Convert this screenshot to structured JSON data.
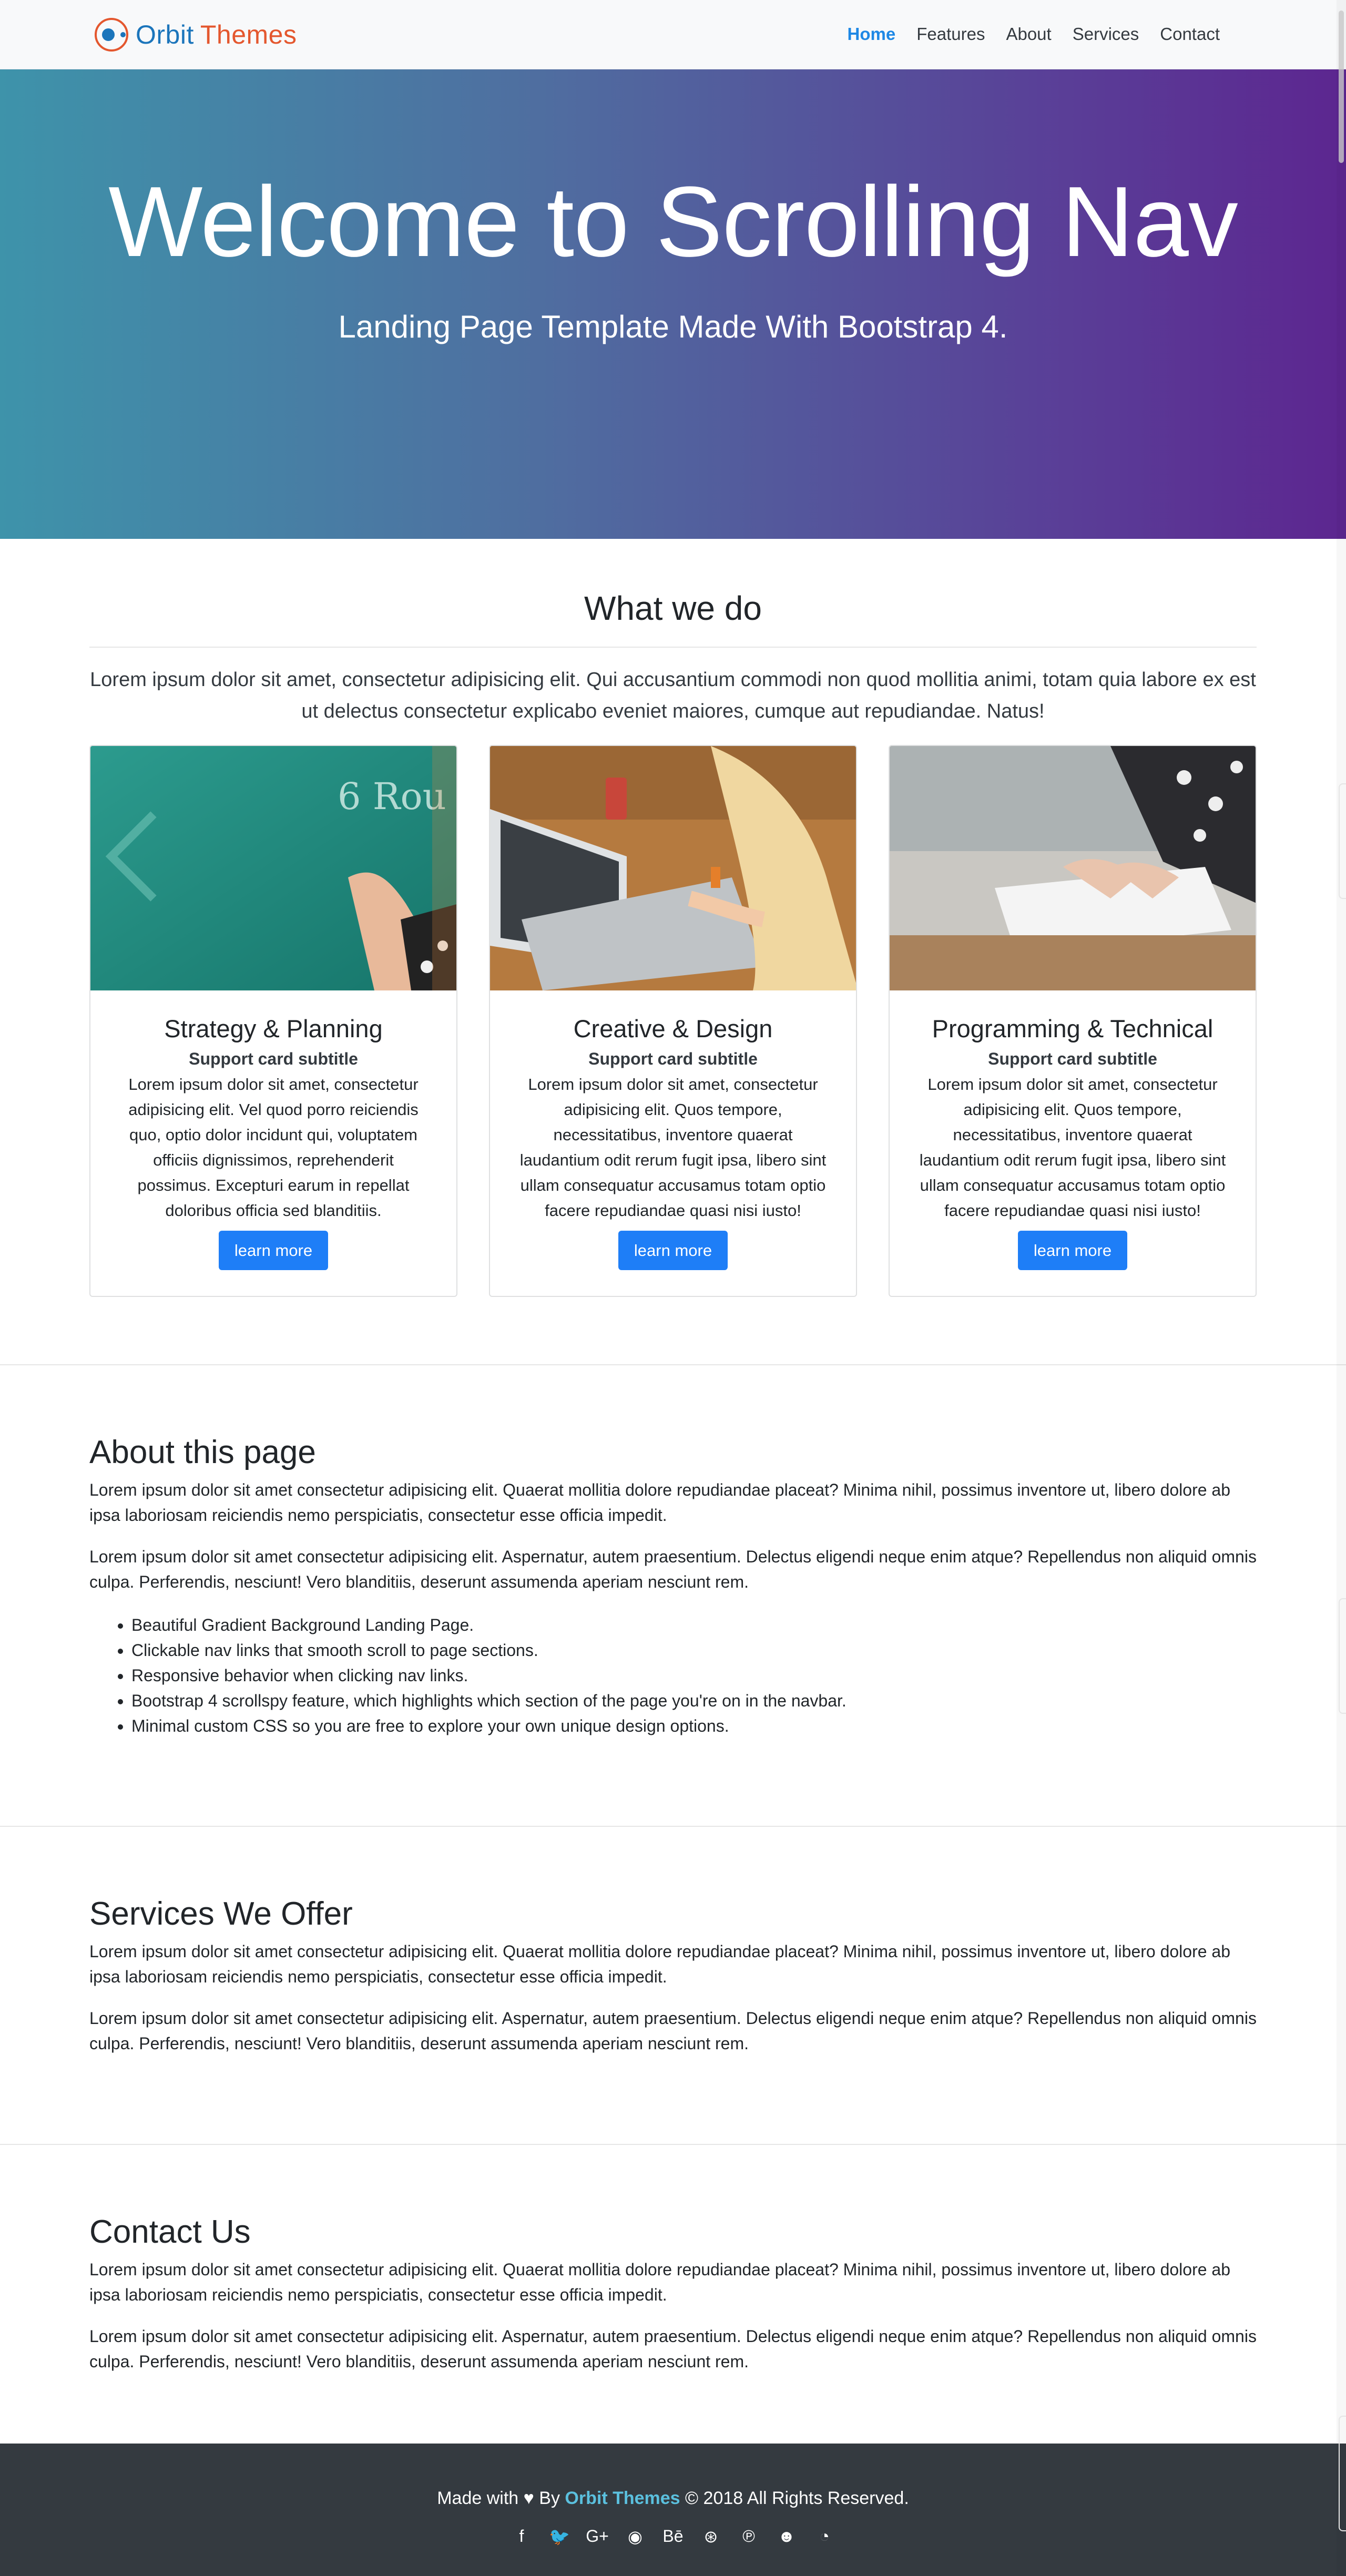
{
  "navbar": {
    "brand_orbit": "Orbit",
    "brand_themes": "Themes",
    "links": [
      "Home",
      "Features",
      "About",
      "Services",
      "Contact"
    ]
  },
  "hero": {
    "title": "Welcome to Scrolling Nav",
    "subtitle": "Landing Page Template Made With Bootstrap 4."
  },
  "what_we_do": {
    "title": "What we do",
    "lead": "Lorem ipsum dolor sit amet, consectetur adipisicing elit. Qui accusantium commodi non quod mollitia animi, totam quia labore ex est ut delectus consectetur explicabo eveniet maiores, cumque aut repudiandae. Natus!",
    "cards": [
      {
        "title": "Strategy & Planning",
        "subtitle": "Support card subtitle",
        "text": "Lorem ipsum dolor sit amet, consectetur adipisicing elit. Vel quod porro reiciendis quo, optio dolor incidunt qui, voluptatem officiis dignissimos, reprehenderit possimus. Excepturi earum in repellat doloribus officia sed blanditiis.",
        "button": "learn more"
      },
      {
        "title": "Creative & Design",
        "subtitle": "Support card subtitle",
        "text": "Lorem ipsum dolor sit amet, consectetur adipisicing elit. Quos tempore, necessitatibus, inventore quaerat laudantium odit rerum fugit ipsa, libero sint ullam consequatur accusamus totam optio facere repudiandae quasi nisi iusto!",
        "button": "learn more"
      },
      {
        "title": "Programming & Technical",
        "subtitle": "Support card subtitle",
        "text": "Lorem ipsum dolor sit amet, consectetur adipisicing elit. Quos tempore, necessitatibus, inventore quaerat laudantium odit rerum fugit ipsa, libero sint ullam consequatur accusamus totam optio facere repudiandae quasi nisi iusto!",
        "button": "learn more"
      }
    ]
  },
  "about": {
    "title": "About this page",
    "p1": "Lorem ipsum dolor sit amet consectetur adipisicing elit. Quaerat mollitia dolore repudiandae placeat? Minima nihil, possimus inventore ut, libero dolore ab ipsa laboriosam reiciendis nemo perspiciatis, consectetur esse officia impedit.",
    "p2": "Lorem ipsum dolor sit amet consectetur adipisicing elit. Aspernatur, autem praesentium. Delectus eligendi neque enim atque? Repellendus non aliquid omnis culpa. Perferendis, nesciunt! Vero blanditiis, deserunt assumenda aperiam nesciunt rem.",
    "features": [
      "Beautiful Gradient Background Landing Page.",
      "Clickable nav links that smooth scroll to page sections.",
      "Responsive behavior when clicking nav links.",
      "Bootstrap 4 scrollspy feature, which highlights which section of the page you're on in the navbar.",
      "Minimal custom CSS so you are free to explore your own unique design options."
    ]
  },
  "services": {
    "title": "Services We Offer",
    "p1": "Lorem ipsum dolor sit amet consectetur adipisicing elit. Quaerat mollitia dolore repudiandae placeat? Minima nihil, possimus inventore ut, libero dolore ab ipsa laboriosam reiciendis nemo perspiciatis, consectetur esse officia impedit.",
    "p2": "Lorem ipsum dolor sit amet consectetur adipisicing elit. Aspernatur, autem praesentium. Delectus eligendi neque enim atque? Repellendus non aliquid omnis culpa. Perferendis, nesciunt! Vero blanditiis, deserunt assumenda aperiam nesciunt rem."
  },
  "contact": {
    "title": "Contact Us",
    "p1": "Lorem ipsum dolor sit amet consectetur adipisicing elit. Quaerat mollitia dolore repudiandae placeat? Minima nihil, possimus inventore ut, libero dolore ab ipsa laboriosam reiciendis nemo perspiciatis, consectetur esse officia impedit.",
    "p2": "Lorem ipsum dolor sit amet consectetur adipisicing elit. Aspernatur, autem praesentium. Delectus eligendi neque enim atque? Repellendus non aliquid omnis culpa. Perferendis, nesciunt! Vero blanditiis, deserunt assumenda aperiam nesciunt rem."
  },
  "footer": {
    "made_with": "Made with",
    "heart": "♥",
    "by": "By",
    "brand": "Orbit Themes",
    "rights": "© 2018 All Rights Reserved.",
    "social_icons": [
      "facebook-icon",
      "twitter-icon",
      "google-plus-icon",
      "github-icon",
      "behance-icon",
      "dribbble-icon",
      "pinterest-icon",
      "reddit-icon",
      "rss-icon"
    ],
    "social_glyphs": [
      "f",
      "🐦",
      "G+",
      "◉",
      "Bē",
      "⊛",
      "℗",
      "☻",
      "◔"
    ]
  },
  "colors": {
    "accent": "#1e7ef7",
    "nav_active": "#1e88e5",
    "brand_blue": "#1b75bb",
    "brand_orange": "#e4572e",
    "footer_bg": "#343a40",
    "footer_link": "#5bc0de",
    "hero_gradient_start": "#3e93aa",
    "hero_gradient_end": "#5c2690"
  }
}
